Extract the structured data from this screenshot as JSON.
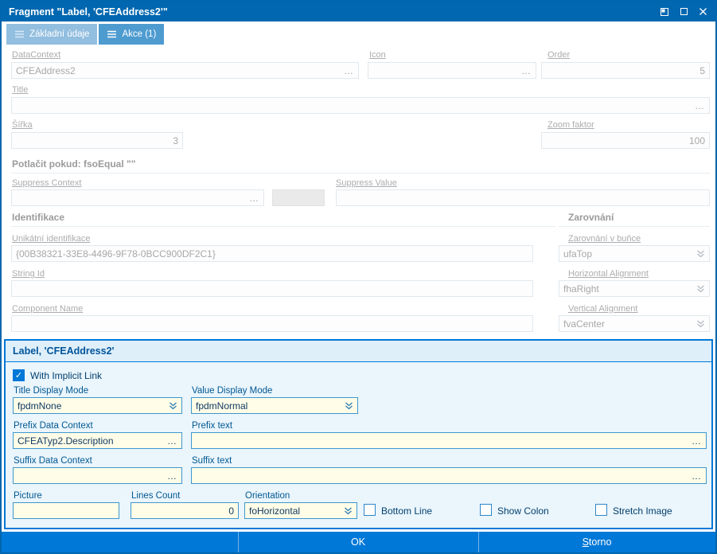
{
  "window": {
    "title": "Fragment \"Label, 'CFEAddress2'\""
  },
  "icons": {
    "ellipsis": "…",
    "check": "✓"
  },
  "tabs": [
    {
      "label": "Základní údaje"
    },
    {
      "label": "Akce (1)"
    }
  ],
  "form": {
    "data_context": {
      "label": "DataContext",
      "value": "CFEAddress2"
    },
    "icon_field": {
      "label": "Icon",
      "value": ""
    },
    "order": {
      "label": "Order",
      "value": "5"
    },
    "title": {
      "label": "Title",
      "value": ""
    },
    "sirka": {
      "label": "Šířka",
      "value": "3"
    },
    "zoom_faktor": {
      "label": "Zoom faktor",
      "value": "100"
    },
    "suppress_header": "Potlačit pokud:  fsoEqual \"\"",
    "suppress_context": {
      "label": "Suppress Context",
      "value": ""
    },
    "suppress_value": {
      "label": "Suppress Value",
      "value": ""
    },
    "identifikace_header": "Identifikace",
    "zarovnani_header": "Zarovnání",
    "unikatni_identifikace": {
      "label": "Unikátní identifikace",
      "value": "{00B38321-33E8-4496-9F78-0BCC900DF2C1}"
    },
    "string_id": {
      "label": "String Id",
      "value": ""
    },
    "component_name": {
      "label": "Component Name",
      "value": ""
    },
    "zarovnani_v_bunce": {
      "label": "Zarovnání v buňce",
      "value": "ufaTop"
    },
    "horizontal_alignment": {
      "label": "Horizontal Alignment",
      "value": "fhaRight"
    },
    "vertical_alignment": {
      "label": "Vertical Alignment",
      "value": "fvaCenter"
    }
  },
  "label_panel": {
    "header": "Label, 'CFEAddress2'",
    "with_implicit_link": {
      "label": "With Implicit Link",
      "checked": true
    },
    "title_display_mode": {
      "label": "Title Display Mode",
      "value": "fpdmNone"
    },
    "value_display_mode": {
      "label": "Value Display Mode",
      "value": "fpdmNormal"
    },
    "prefix_data_context": {
      "label": "Prefix Data Context",
      "value": "CFEATyp2.Description"
    },
    "prefix_text": {
      "label": "Prefix text",
      "value": ""
    },
    "suffix_data_context": {
      "label": "Suffix Data Context",
      "value": ""
    },
    "suffix_text": {
      "label": "Suffix text",
      "value": ""
    },
    "picture": {
      "label": "Picture",
      "value": ""
    },
    "lines_count": {
      "label": "Lines Count",
      "value": "0"
    },
    "orientation": {
      "label": "Orientation",
      "value": "foHorizontal"
    },
    "bottom_line": {
      "label": "Bottom Line",
      "checked": false
    },
    "show_colon": {
      "label": "Show Colon",
      "checked": false
    },
    "stretch_image": {
      "label": "Stretch Image",
      "checked": false
    }
  },
  "footer": {
    "ok": "OK",
    "storno_accel": "S",
    "storno_rest": "torno"
  },
  "colors": {
    "titlebar": "#0067B0",
    "accent": "#0078D7",
    "panel_bg": "#EAF5FC",
    "field_active_bg": "#FFFDE7",
    "disabled_text": "#A8A8A8"
  }
}
